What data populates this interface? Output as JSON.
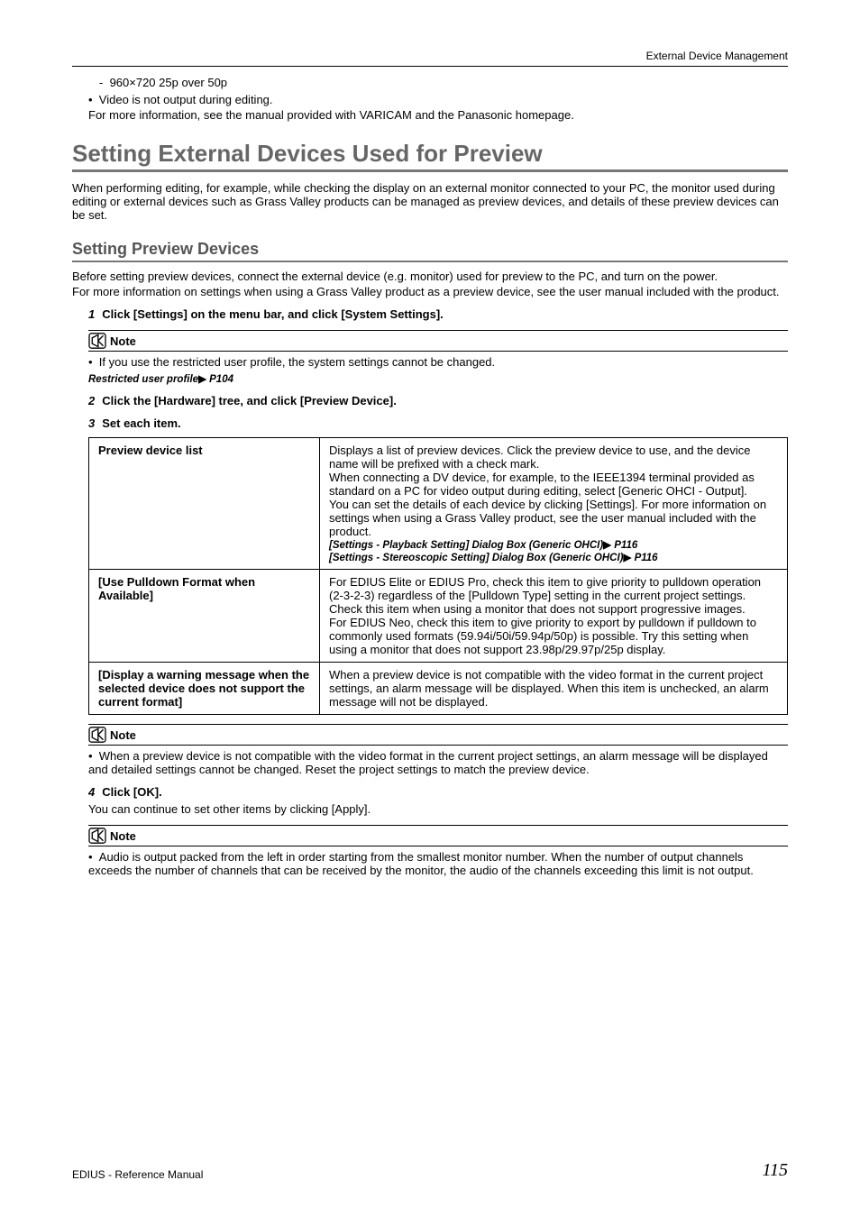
{
  "header": {
    "right": "External Device Management"
  },
  "intro": {
    "format": "960×720 25p over 50p",
    "video_line": "Video is not output during editing.",
    "more_info": "For more information, see the manual provided with VARICAM and the Panasonic homepage."
  },
  "h1": "Setting External Devices Used for Preview",
  "h1_body": "When performing editing, for example, while checking the display on an external monitor connected to your PC, the monitor used during editing or external devices such as Grass Valley products can be managed as preview devices, and details of these preview devices can be set.",
  "h2": "Setting Preview Devices",
  "h2_body1": "Before setting preview devices, connect the external device (e.g. monitor) used for preview to the PC, and turn on the power.",
  "h2_body2": "For more information on settings when using a Grass Valley product as a preview device, see the user manual included with the product.",
  "steps": {
    "s1": "Click [Settings] on the menu bar, and click [System Settings].",
    "s2": "Click the [Hardware] tree, and click [Preview Device].",
    "s3": "Set each item.",
    "s4": "Click [OK]."
  },
  "note_label": "Note",
  "note1_text": "If you use the restricted user profile, the system settings cannot be changed.",
  "note1_ref": "Restricted user profile",
  "note1_page": " P104",
  "table": {
    "r1": {
      "label": "Preview device list",
      "p1": "Displays a list of preview devices. Click the preview device to use, and the device name will be prefixed with a check mark.",
      "p2": "When connecting a DV device, for example, to the IEEE1394 terminal provided as standard on a PC for video output during editing, select [Generic OHCI - Output].",
      "p3": "You can set the details of each device by clicking [Settings]. For more information on settings when using a Grass Valley product, see the user manual included with the product.",
      "ref1": "[Settings - Playback Setting] Dialog Box (Generic OHCI)",
      "ref1_page": " P116",
      "ref2": "[Settings - Stereoscopic Setting] Dialog Box (Generic OHCI)",
      "ref2_page": " P116"
    },
    "r2": {
      "label": "[Use Pulldown Format when Available]",
      "p1": "For EDIUS Elite or EDIUS Pro, check this item to give priority to pulldown operation (2-3-2-3) regardless of the [Pulldown Type] setting in the current project settings. Check this item when using a monitor that does not support progressive images.",
      "p2": "For EDIUS Neo, check this item to give priority to export by pulldown if pulldown to commonly used formats (59.94i/50i/59.94p/50p) is possible. Try this setting when using a monitor that does not support 23.98p/29.97p/25p display."
    },
    "r3": {
      "label": "[Display a warning message when the selected device does not support the current format]",
      "p1": "When a preview device is not compatible with the video format in the current project settings, an alarm message will be displayed. When this item is unchecked, an alarm message will not be displayed."
    }
  },
  "note2_text": "When a preview device is not compatible with the video format in the current project settings, an alarm message will be displayed and detailed settings cannot be changed. Reset the project settings to match the preview device.",
  "after_s4": "You can continue to set other items by clicking [Apply].",
  "note3_text": "Audio is output packed from the left in order starting from the smallest monitor number. When the number of output channels exceeds the number of channels that can be received by the monitor, the audio of the channels exceeding this limit is not output.",
  "footer": {
    "left": "EDIUS - Reference Manual",
    "right": "115"
  }
}
